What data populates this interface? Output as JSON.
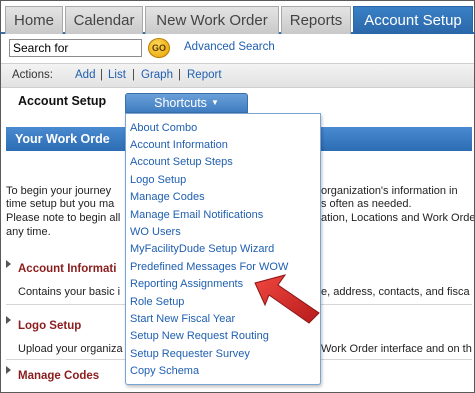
{
  "tabs": [
    {
      "label": "Home",
      "active": false
    },
    {
      "label": "Calendar",
      "active": false
    },
    {
      "label": "New Work Order",
      "active": false
    },
    {
      "label": "Reports",
      "active": false
    },
    {
      "label": "Account Setup",
      "active": true
    }
  ],
  "search": {
    "value": "Search for",
    "go_label": "GO",
    "advanced_label": "Advanced Search"
  },
  "actions": {
    "label": "Actions:",
    "items": [
      "Add",
      "List",
      "Graph",
      "Report"
    ]
  },
  "account_setup": {
    "title": "Account Setup",
    "shortcuts_label": "Shortcuts"
  },
  "work_order_bar": {
    "title": "Your Work Orde"
  },
  "body": {
    "intro_line1": "To begin your journey",
    "intro_line1_right": "organization's information in",
    "intro_line2": "time setup but you ma",
    "intro_line2_right": "s often as needed.",
    "intro_line3": "Please note to begin all",
    "intro_line3_right": "ation, Locations and Work Order",
    "intro_line4": "any time.",
    "sections": [
      {
        "title": "Account Informati",
        "desc_left": "Contains your basic i",
        "desc_right": "e, address, contacts, and fisca"
      },
      {
        "title": "Logo Setup",
        "desc_left": "Upload your organiza",
        "desc_right": "Work Order interface and on th"
      },
      {
        "title": "Manage Codes",
        "desc_left": "",
        "desc_right": ""
      }
    ]
  },
  "shortcuts_menu": [
    "About Combo",
    "Account Information",
    "Account Setup Steps",
    "Logo Setup",
    "Manage Codes",
    "Manage Email Notifications",
    "WO Users",
    "MyFacilityDude Setup Wizard",
    "Predefined Messages For WOW",
    "Reporting Assignments",
    "Role Setup",
    "Start New Fiscal Year",
    "Setup New Request Routing",
    "Setup Requester Survey",
    "Copy Schema"
  ],
  "colors": {
    "accent": "#2f71b4",
    "link": "#1f5fb0",
    "section_head": "#8b1d1d",
    "annotation_arrow": "#d8262a"
  }
}
